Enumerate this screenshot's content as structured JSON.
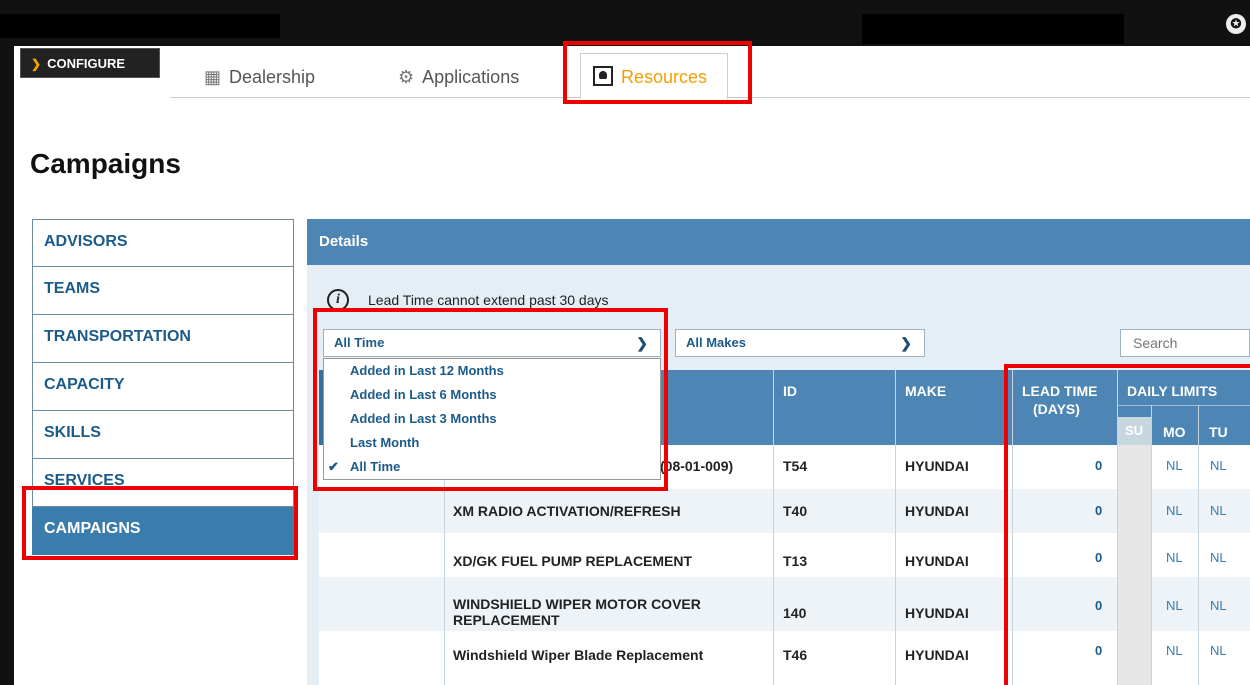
{
  "header": {
    "configure_label": "CONFIGURE",
    "configure_chevron": "chevron-down-icon",
    "tabs": [
      {
        "label": "Dealership",
        "icon": "calendar-icon"
      },
      {
        "label": "Applications",
        "icon": "gears-icon"
      },
      {
        "label": "Resources",
        "icon": "person-icon"
      }
    ],
    "star_glyph": "✪"
  },
  "page_title": "Campaigns",
  "sidebar": {
    "items": [
      {
        "label": "ADVISORS"
      },
      {
        "label": "TEAMS"
      },
      {
        "label": "TRANSPORTATION"
      },
      {
        "label": "CAPACITY"
      },
      {
        "label": "SKILLS"
      },
      {
        "label": "SERVICES"
      },
      {
        "label": "CAMPAIGNS"
      }
    ]
  },
  "details": {
    "title": "Details",
    "info_text": "Lead Time cannot extend past 30 days",
    "time_filter": {
      "selected": "All Time",
      "options": [
        "Added in Last 12 Months",
        "Added in Last 6 Months",
        "Added in Last 3 Months",
        "Last Month",
        "All Time"
      ]
    },
    "make_filter": {
      "selected": "All Makes"
    },
    "search_placeholder": "Search"
  },
  "table": {
    "headers": {
      "id": "ID",
      "make": "MAKE",
      "lead_time_1": "LEAD TIME",
      "lead_time_2": "(DAYS)",
      "daily_limits": "DAILY LIMITS",
      "days": [
        "SU",
        "MO",
        "TU"
      ]
    },
    "rows": [
      {
        "name": "(08-01-009)",
        "id": "T54",
        "make": "HYUNDAI",
        "lead": "0",
        "mo": "NL",
        "tu": "NL"
      },
      {
        "name": "XM RADIO ACTIVATION/REFRESH",
        "id": "T40",
        "make": "HYUNDAI",
        "lead": "0",
        "mo": "NL",
        "tu": "NL"
      },
      {
        "name": "XD/GK FUEL PUMP REPLACEMENT",
        "id": "T13",
        "make": "HYUNDAI",
        "lead": "0",
        "mo": "NL",
        "tu": "NL"
      },
      {
        "name_1": "WINDSHIELD WIPER MOTOR COVER",
        "name_2": "REPLACEMENT",
        "id": "140",
        "make": "HYUNDAI",
        "lead": "0",
        "mo": "NL",
        "tu": "NL"
      },
      {
        "name": "Windshield Wiper Blade Replacement",
        "id": "T46",
        "make": "HYUNDAI",
        "lead": "0",
        "mo": "NL",
        "tu": "NL"
      }
    ]
  },
  "colors": {
    "accent_orange": "#f0a000",
    "header_blue": "#4d86b4",
    "highlight_red": "#e00000"
  }
}
